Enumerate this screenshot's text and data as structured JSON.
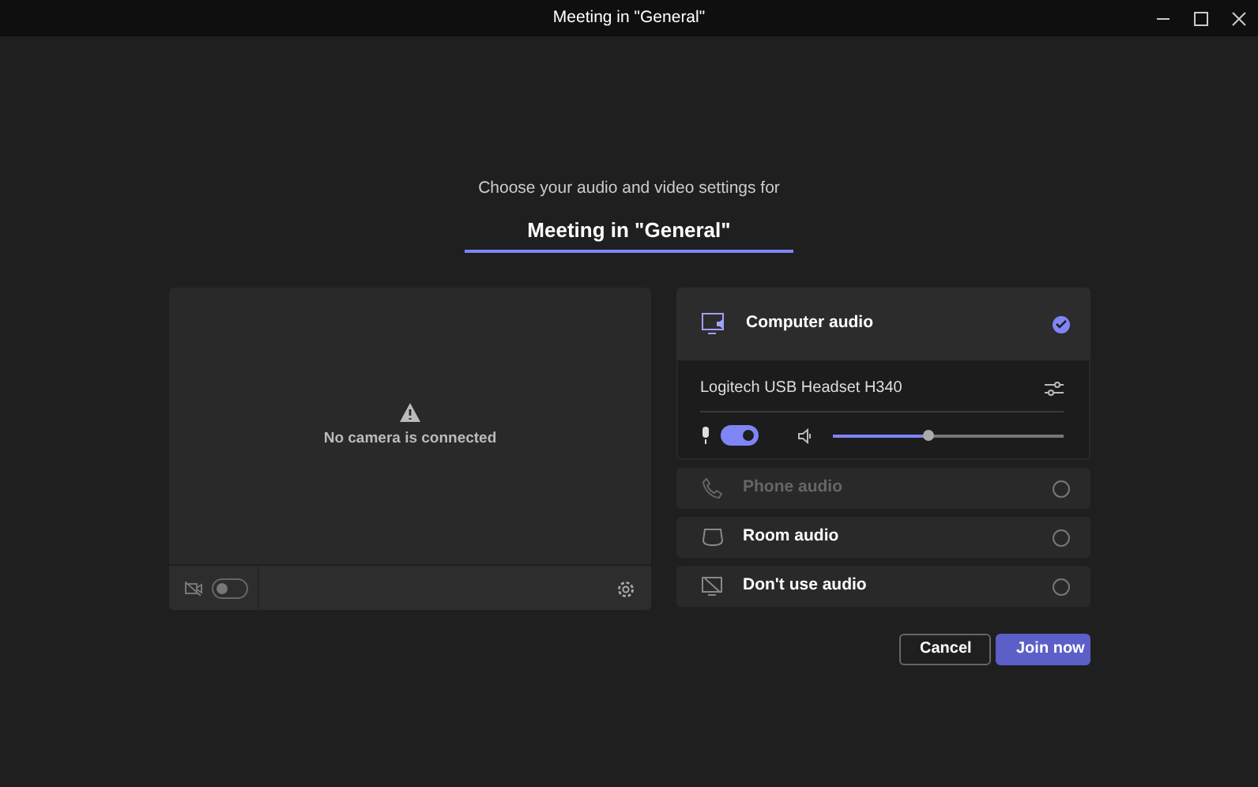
{
  "window": {
    "title": "Meeting in \"General\""
  },
  "prompt": "Choose your audio and video settings for",
  "meeting_name": {
    "value": "Meeting in \"General\""
  },
  "camera": {
    "message": "No camera is connected",
    "on": false
  },
  "audio_options": [
    {
      "kind": "computer",
      "label": "Computer audio",
      "selected": true,
      "disabled": false
    },
    {
      "kind": "phone",
      "label": "Phone audio",
      "selected": false,
      "disabled": true
    },
    {
      "kind": "room",
      "label": "Room audio",
      "selected": false,
      "disabled": false
    },
    {
      "kind": "none",
      "label": "Don't use audio",
      "selected": false,
      "disabled": false
    }
  ],
  "device": {
    "name": "Logitech USB Headset H340",
    "mic_on": true,
    "volume": {
      "level": 0.41
    }
  },
  "buttons": [
    {
      "kind": "secondary",
      "label": "Cancel"
    },
    {
      "kind": "primary",
      "label": "Join now"
    }
  ]
}
